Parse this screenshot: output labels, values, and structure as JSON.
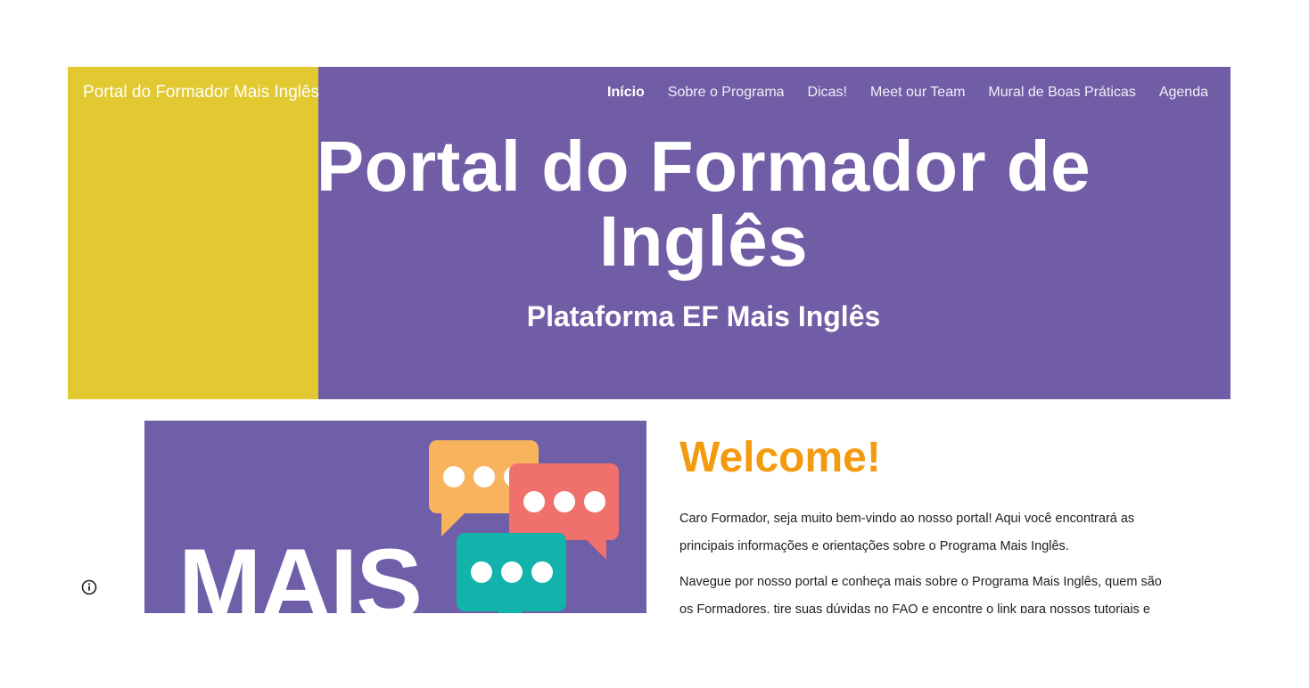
{
  "header": {
    "site_title": "Portal do Formador Mais Inglês",
    "nav": [
      {
        "label": "Início",
        "active": true
      },
      {
        "label": "Sobre o Programa",
        "active": false
      },
      {
        "label": "Dicas!",
        "active": false
      },
      {
        "label": "Meet our Team",
        "active": false
      },
      {
        "label": "Mural de Boas Práticas",
        "active": false
      },
      {
        "label": "Agenda",
        "active": false
      }
    ]
  },
  "hero": {
    "title": "Portal do Formador de Inglês",
    "subtitle": "Plataforma EF Mais Inglês",
    "colors": {
      "background": "#715da6",
      "accent_block": "#e2c831"
    }
  },
  "promo_image": {
    "text": "MAIS",
    "bubble_colors": [
      "#f8b35d",
      "#ef706c",
      "#12b3aa"
    ],
    "background": "#6f5ea8"
  },
  "content": {
    "welcome_heading": "Welcome!",
    "welcome_color": "#f49a0f",
    "paragraphs": [
      "Caro Formador, seja muito bem-vindo ao nosso portal! Aqui você encontrará as principais informações e orientações sobre o Programa Mais Inglês.",
      "Navegue por nosso portal e conheça mais sobre o Programa Mais Inglês, quem são os Formadores, tire suas dúvidas no FAQ e encontre o link para nossos tutoriais e"
    ]
  },
  "info_button": {
    "icon": "info-icon"
  }
}
